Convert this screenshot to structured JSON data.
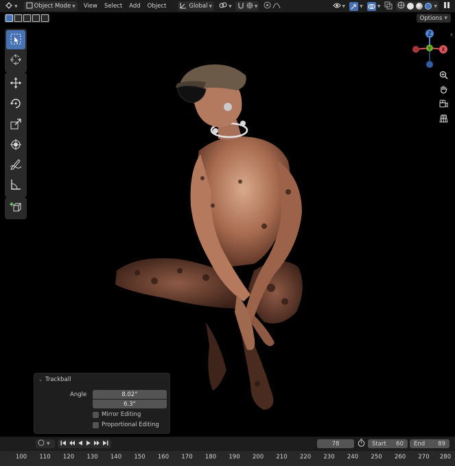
{
  "header": {
    "mode_label": "Object Mode",
    "menus": [
      "View",
      "Select",
      "Add",
      "Object"
    ],
    "orientation_label": "Global"
  },
  "options_label": "Options",
  "gizmo": {
    "z": "Z",
    "y": "Y",
    "x": "X"
  },
  "operator_panel": {
    "title": "Trackball",
    "angle_label": "Angle",
    "angle_value_1": "8.02°",
    "angle_value_2": "6.3°",
    "mirror_label": "Mirror Editing",
    "proportional_label": "Proportional Editing"
  },
  "timeline": {
    "current_frame": "78",
    "start_label": "Start",
    "start_value": "60",
    "end_label": "End",
    "end_value": "89",
    "ticks": [
      "100",
      "110",
      "120",
      "130",
      "140",
      "150",
      "160",
      "170",
      "180",
      "190",
      "200",
      "210",
      "220",
      "230",
      "240",
      "250",
      "260",
      "270",
      "280"
    ]
  },
  "colors": {
    "accent": "#4772b3",
    "axis_x": "#e0565b",
    "axis_y": "#6fb52c",
    "axis_z": "#4f86d7"
  },
  "icons": [
    "editor-type-icon",
    "object-mode-icon",
    "orientation-icon",
    "pivot-icon",
    "snap-icon",
    "proportional-icon",
    "visibility-icon",
    "gizmo-icon",
    "overlay-icon",
    "xray-icon",
    "shading-icons",
    "select-box-icon",
    "cursor-icon",
    "move-icon",
    "rotate-icon",
    "scale-icon",
    "transform-icon",
    "annotate-icon",
    "measure-icon",
    "add-cube-icon",
    "zoom-icon",
    "hand-icon",
    "camera-icon",
    "grid-icon",
    "play-icon",
    "stopwatch-icon"
  ]
}
